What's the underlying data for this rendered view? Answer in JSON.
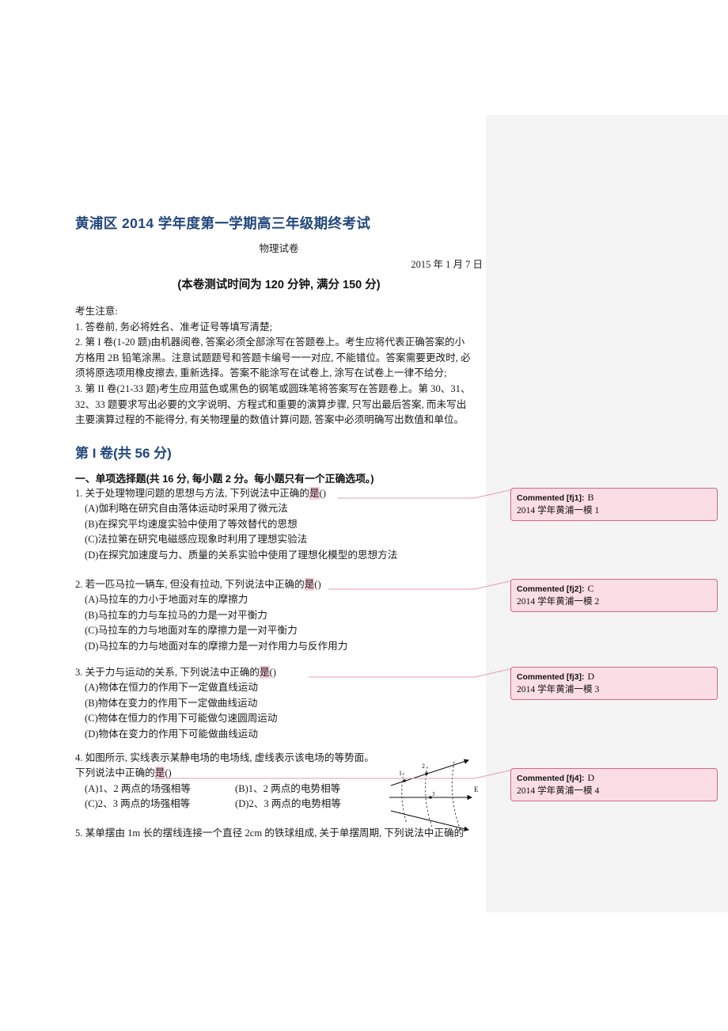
{
  "document": {
    "title": "黄浦区 2014 学年度第一学期高三年级期终考试",
    "subject": "物理试卷",
    "date": "2015 年 1 月 7 日",
    "exam_note": "(本卷测试时间为 120 分钟, 满分 150 分)"
  },
  "notice": {
    "heading": "考生注意:",
    "lines": [
      "1. 答卷前, 务必将姓名、准考证号等填写清楚;",
      "2. 第 I 卷(1-20 题)由机器阅卷, 答案必须全部涂写在答题卷上。考生应将代表正确答案的小",
      "方格用 2B 铅笔涂黑。注意试题题号和答题卡编号一一对应, 不能错位。答案需要更改时, 必",
      "须将原选项用橡皮擦去, 重新选择。答案不能涂写在试卷上, 涂写在试卷上一律不给分;",
      "3. 第 II 卷(21-33 题)考生应用蓝色或黑色的钢笔或圆珠笔将答案写在答题卷上。第 30、31、",
      "32、33 题要求写出必要的文字说明、方程式和重要的演算步骤, 只写出最后答案, 而未写出",
      "主要演算过程的不能得分, 有关物理量的数值计算问题, 答案中必须明确写出数值和单位。"
    ]
  },
  "part": {
    "title": "第 I 卷(共 56 分)",
    "section_title": "一、单项选择题(共 16 分, 每小题 2 分。每小题只有一个正确选项。)"
  },
  "questions": [
    {
      "number": "1.",
      "stem_before": "关于处理物理问题的思想与方法, 下列说法中正确的",
      "stem_highlight": "是",
      "stem_after": "()",
      "options": [
        "(A)伽利略在研究自由落体运动时采用了微元法",
        "(B)在探究平均速度实验中使用了等效替代的思想",
        "(C)法拉第在研究电磁感应现象时利用了理想实验法",
        "(D)在探究加速度与力、质量的关系实验中使用了理想化模型的思想方法"
      ]
    },
    {
      "number": "2.",
      "stem_before": "若一匹马拉一辆车, 但没有拉动, 下列说法中正确的",
      "stem_highlight": "是",
      "stem_after": "()",
      "options": [
        "(A)马拉车的力小于地面对车的摩擦力",
        "(B)马拉车的力与车拉马的力是一对平衡力",
        "(C)马拉车的力与地面对车的摩擦力是一对平衡力",
        "(D)马拉车的力与地面对车的摩擦力是一对作用力与反作用力"
      ]
    },
    {
      "number": "3.",
      "stem_before": "关于力与运动的关系, 下列说法中正确的",
      "stem_highlight": "是",
      "stem_after": "()",
      "options": [
        "(A)物体在恒力的作用下一定做直线运动",
        "(B)物体在变力的作用下一定做曲线运动",
        "(C)物体在恒力的作用下可能做匀速圆周运动",
        "(D)物体在变力的作用下可能做曲线运动"
      ]
    },
    {
      "number": "4.",
      "stem_line1": "如图所示, 实线表示某静电场的电场线, 虚线表示该电场的等势面。",
      "stem_line2_before": "下列说法中正确的",
      "stem_highlight": "是",
      "stem_after": "()",
      "option_rows": [
        {
          "a": "(A)1、2 两点的场强相等",
          "b": "(B)1、2 两点的电势相等"
        },
        {
          "a": "(C)2、3 两点的场强相等",
          "b": "(D)2、3 两点的电势相等"
        }
      ],
      "figure": {
        "point_labels": [
          "1",
          "2",
          "3"
        ],
        "field_label": "E"
      }
    },
    {
      "number": "5.",
      "stem_text": "某单摆由 1m 长的摆线连接一个直径 2cm 的铁球组成, 关于单摆周期, 下列说法中正确的"
    }
  ],
  "comments": [
    {
      "label": "Commented [fj1]:",
      "value": "B",
      "body": "2014 学年黄浦一模 1"
    },
    {
      "label": "Commented [fj2]:",
      "value": "C",
      "body": "2014 学年黄浦一模 2"
    },
    {
      "label": "Commented [fj3]:",
      "value": "D",
      "body": "2014 学年黄浦一模 3"
    },
    {
      "label": "Commented [fj4]:",
      "value": "D",
      "body": "2014 学年黄浦一模 4"
    }
  ],
  "colors": {
    "heading_blue": "#23477c",
    "highlight_pink": "#f6cdd9",
    "comment_bg": "#fbdde6",
    "comment_border": "#d06888",
    "gutter_gray": "#f4f4f4"
  }
}
